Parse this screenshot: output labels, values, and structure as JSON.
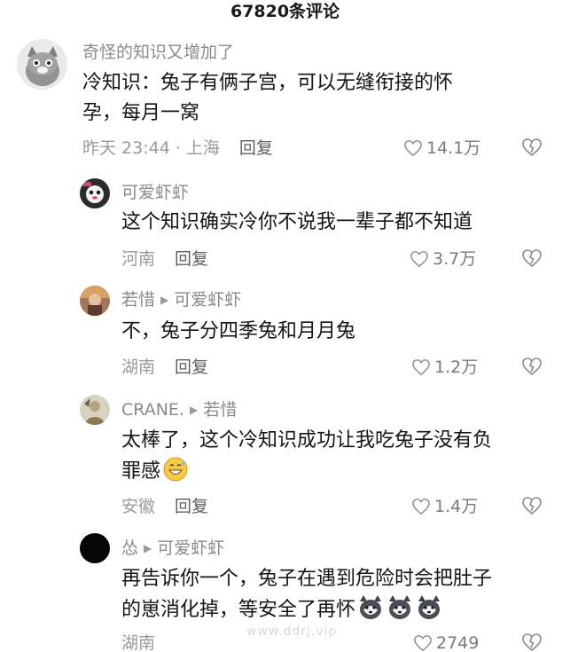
{
  "header": {
    "title": "67820条评论"
  },
  "comments": [
    {
      "user": "奇怪的知识又增加了",
      "text_lines": [
        "冷知识：兔子有俩子宫，可以无缝衔接的怀",
        "孕，每月一窝"
      ],
      "time_location": "昨天 23:44 · 上海",
      "reply_label": "回复",
      "likes": "14.1万",
      "avatar_icon": "cat-avatar"
    },
    {
      "user": "可爱虾虾",
      "text_lines": [
        "这个知识确实冷你不说我一辈子都不知道"
      ],
      "time_location": "河南",
      "reply_label": "回复",
      "likes": "3.7万",
      "avatar_icon": "cartoon-avatar"
    },
    {
      "user": "若惜",
      "reply_to": "可爱虾虾",
      "text_lines": [
        "不，兔子分四季兔和月月兔"
      ],
      "time_location": "湖南",
      "reply_label": "回复",
      "likes": "1.2万",
      "avatar_icon": "person-avatar"
    },
    {
      "user": "CRANE.",
      "reply_to": "若惜",
      "text_lines": [
        "太棒了，这个冷知识成功让我吃兔子没有负",
        "罪感"
      ],
      "emoji": "grinning-sweat-emoji",
      "time_location": "安徽",
      "reply_label": "回复",
      "likes": "1.4万",
      "avatar_icon": "figure-avatar"
    },
    {
      "user": "怂",
      "reply_to": "可爱虾虾",
      "text_lines": [
        "再告诉你一个，兔子在遇到危险时会把肚子",
        "的崽消化掉，等安全了再怀"
      ],
      "emoji": "husky-emoji",
      "time_location": "湖南",
      "reply_label": "回复",
      "likes": "2749",
      "avatar_icon": "black-avatar"
    }
  ],
  "watermark": "www.ddrj.vip",
  "colors": {
    "name": "#8a8a8a",
    "text": "#141414",
    "meta": "#9a9a9a"
  }
}
